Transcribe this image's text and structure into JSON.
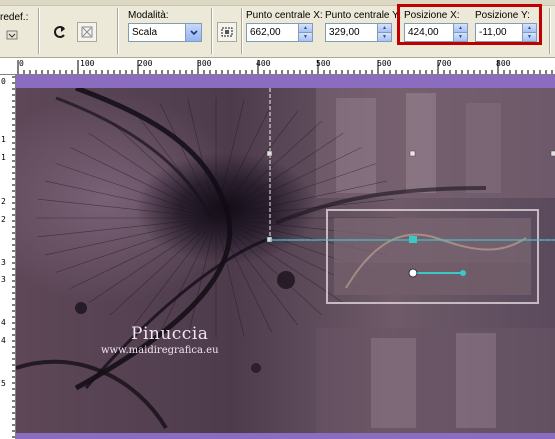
{
  "toolbar": {
    "preset_label": "redef.:",
    "mode_label": "Modalità:",
    "mode_value": "Scala",
    "center_x_label": "Punto centrale X:",
    "center_x_value": "662,00",
    "center_y_label": "Punto centrale Y:",
    "center_y_value": "329,00",
    "pos_x_label": "Posizione X:",
    "pos_x_value": "424,00",
    "pos_y_label": "Posizione Y:",
    "pos_y_value": "-11,00"
  },
  "ruler": {
    "top_ticks": [
      "0",
      "100",
      "200",
      "300",
      "400",
      "500",
      "600",
      "700",
      "800"
    ],
    "left_ticks": [
      "0",
      "1",
      "1",
      "2",
      "2",
      "3",
      "3",
      "4",
      "4",
      "5"
    ]
  },
  "watermark": {
    "title": "Pinuccia",
    "url": "www.maidiregrafica.eu"
  },
  "colors": {
    "highlight": "#c00000",
    "workspace": "#8a6cc0",
    "handle_accent": "#3cc8c8"
  }
}
